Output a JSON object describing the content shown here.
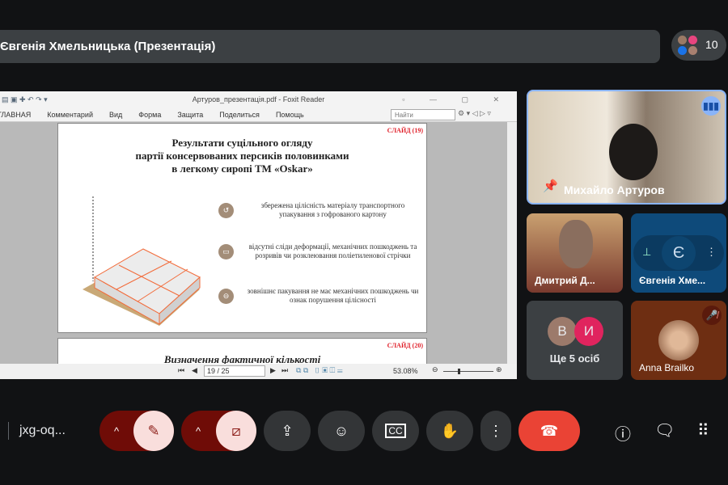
{
  "banner": {
    "title": "Євгенія Хмельницька (Презентація)"
  },
  "participants": {
    "count": "10"
  },
  "foxit": {
    "window_title": "Артуров_презентація.pdf - Foxit Reader",
    "ribbon_tabs": [
      "ГЛАВНАЯ",
      "Комментарий",
      "Вид",
      "Форма",
      "Защита",
      "Поделиться",
      "Помощь"
    ],
    "search_placeholder": "Найти",
    "slide19": {
      "label": "СЛАЙД (19)",
      "title": [
        "Результати суцільного огляду",
        "партії  консервованих персиків половинками",
        "в легкому сиропі ТМ «Oskar»"
      ],
      "bullets": [
        "збережена цілісність матеріалу транспортного упакування з гофрованого картону",
        "відсутні сліди деформації, механічних пошкоджень та розривів чи розклеювання поліетиленової стрічки",
        "зовнішнє пакування не має механічних пошкоджень чи ознак порушення цілісності"
      ]
    },
    "slide20": {
      "label": "СЛАЙД (20)",
      "title": "Визначення фактичної кількості"
    },
    "page_field": "19 / 25",
    "zoom": "53.08%",
    "zoom_level_fraction": 0.3
  },
  "tiles": {
    "main": {
      "name": "Михайло Артуров"
    },
    "t1": {
      "name": "Дмитрий Д..."
    },
    "t2": {
      "name": "Євгенія Хме...",
      "avatar": "Є"
    },
    "t3": {
      "avatar1": "В",
      "avatar2": "И",
      "label": "Ще 5 осіб"
    },
    "t4": {
      "name": "Anna Brailko"
    }
  },
  "bottom": {
    "meeting_code": "jxg-oq..."
  },
  "colors": {
    "accent": "#8ab4f8",
    "end_call": "#ea4335",
    "muted_dark": "#6f0c07",
    "muted_light": "#f9dedc"
  }
}
